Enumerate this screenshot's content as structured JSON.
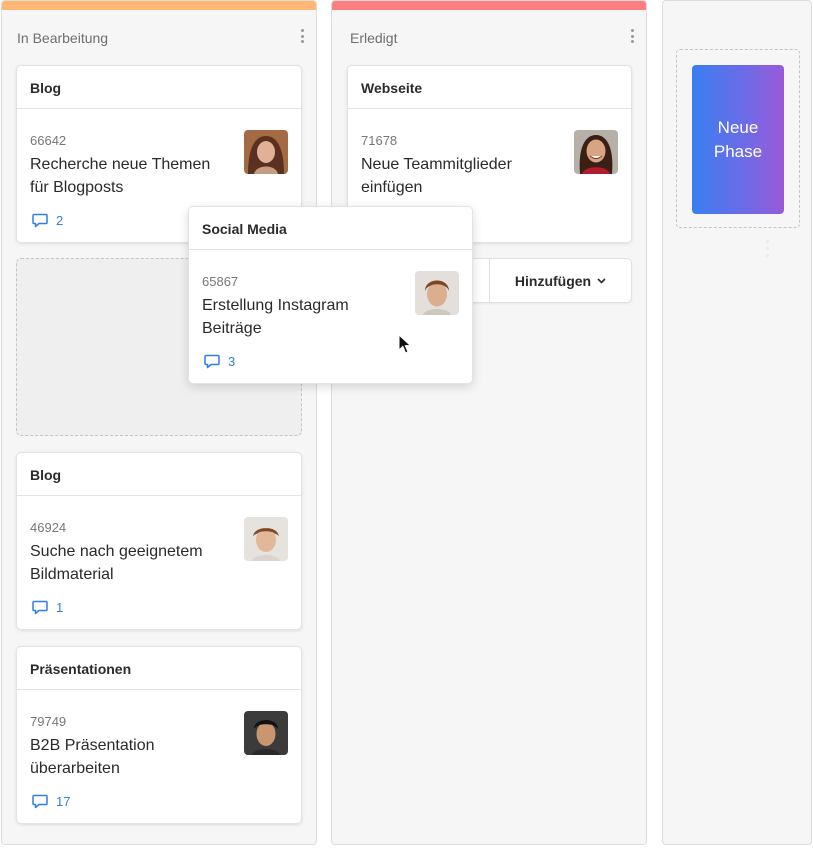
{
  "columns": [
    {
      "title": "In Bearbeitung",
      "bar_color": "#ffb774"
    },
    {
      "title": "Erledigt",
      "bar_color": "#ff7f7f"
    }
  ],
  "cards": {
    "blog1": {
      "category": "Blog",
      "id": "66642",
      "title": "Recherche neue Themen für Blogposts",
      "comments": "2"
    },
    "web": {
      "category": "Webseite",
      "id": "71678",
      "title": "Neue Teammitglieder einfügen"
    },
    "blog2": {
      "category": "Blog",
      "id": "46924",
      "title": "Suche nach geeignetem Bildmaterial",
      "comments": "1"
    },
    "praes": {
      "category": "Präsentationen",
      "id": "79749",
      "title": "B2B Präsentation überarbeiten",
      "comments": "17"
    },
    "social": {
      "category": "Social Media",
      "id": "65867",
      "title": "Erstellung Instagram Beiträge",
      "comments": "3"
    }
  },
  "add_button_label": "Hinzufügen",
  "new_phase_label": "Neue Phase",
  "colors": {
    "accent": "#2f7fe0"
  },
  "icons": {
    "comment": "comment-icon",
    "menu": "kebab-menu-icon",
    "chevron": "chevron-down-icon",
    "cursor": "mouse-pointer-icon"
  }
}
